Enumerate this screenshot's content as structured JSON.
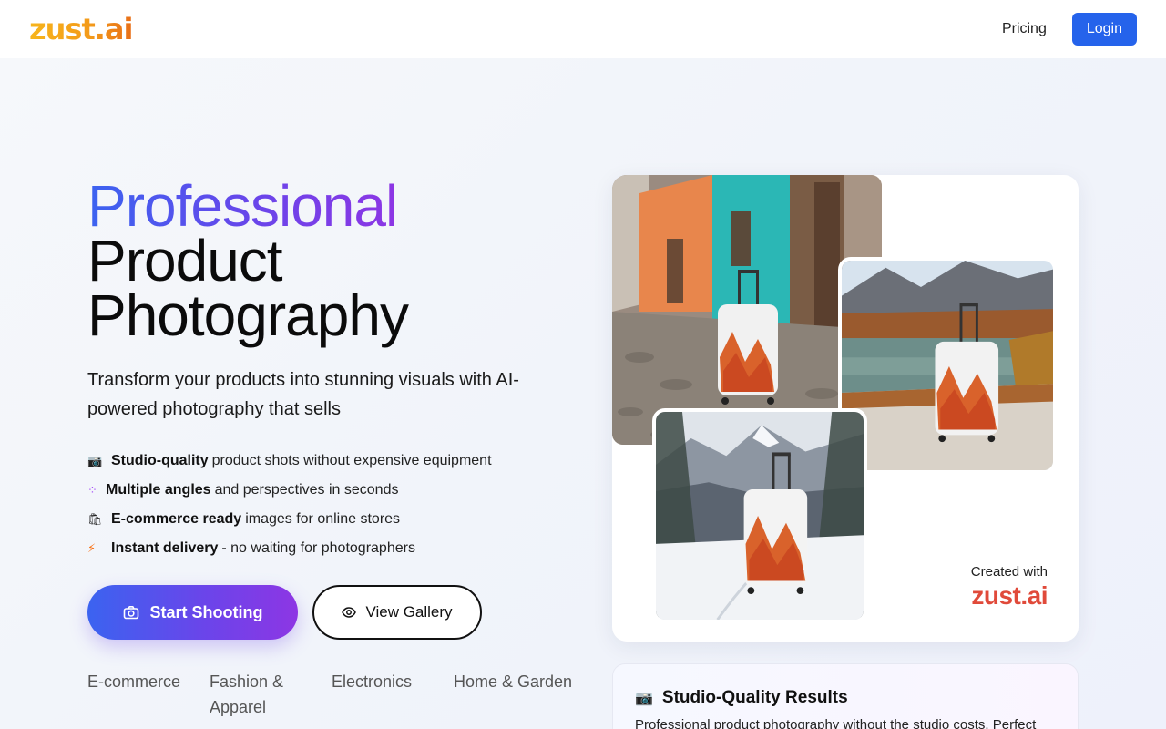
{
  "header": {
    "logo": "zust.ai",
    "nav": {
      "pricing": "Pricing",
      "login": "Login"
    }
  },
  "hero": {
    "title_highlight": "Professional",
    "title_line2": "Product",
    "title_line3": "Photography",
    "subtitle": "Transform your products into stunning visuals with AI-powered photography that sells",
    "features": [
      {
        "icon": "camera-icon",
        "bold": "Studio-quality",
        "text": "product shots without expensive equipment"
      },
      {
        "icon": "angles-icon",
        "bold": "Multiple angles",
        "text": "and perspectives in seconds"
      },
      {
        "icon": "shopping-bag-icon",
        "bold": "E-commerce ready",
        "text": "images for online stores"
      },
      {
        "icon": "lightning-icon",
        "bold": "Instant delivery",
        "text": "- no waiting for photographers"
      }
    ],
    "primary_cta": "Start Shooting",
    "secondary_cta": "View Gallery",
    "categories": [
      "E-commerce",
      "Fashion & Apparel",
      "Electronics",
      "Home & Garden"
    ]
  },
  "showcase": {
    "created_label": "Created with",
    "created_brand": "zust.ai"
  },
  "card": {
    "title": "Studio-Quality Results",
    "text": "Professional product photography without the studio costs. Perfect"
  },
  "colors": {
    "accent_blue": "#2563eb",
    "gradient_start": "#3b63f0",
    "gradient_end": "#8d36e4",
    "logo_orange": "#f39a1a",
    "brand_red": "#e04a3a"
  }
}
